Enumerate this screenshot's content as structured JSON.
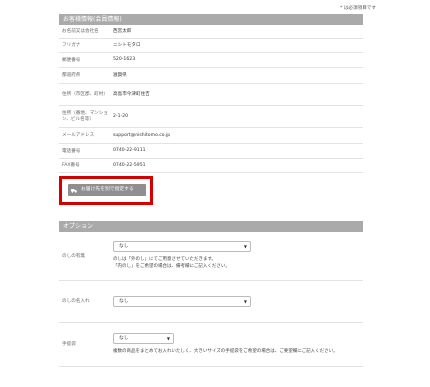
{
  "required_note": "* は必須項目です",
  "customer": {
    "header": "お客様情報(会員情報)",
    "rows": [
      {
        "label": "お名前又は会社名",
        "value": "西宮太郎"
      },
      {
        "label": "フリガナ",
        "value": "ニシトモタロ"
      },
      {
        "label": "郵便番号",
        "value": "520-1623"
      },
      {
        "label": "都道府県",
        "value": "滋賀県"
      },
      {
        "label": "住所（市区郡、町村）",
        "value": "高島市今津町住吉"
      },
      {
        "label": "住所（番地、マンション、ビル名等）",
        "value": "2-1-20"
      },
      {
        "label": "メールアドレス",
        "value": "support@nishitomo.co.jp"
      },
      {
        "label": "電話番号",
        "value": "0740-22-9111"
      },
      {
        "label": "FAX番号",
        "value": "0740-22-5951"
      }
    ]
  },
  "change_button_label": "お届け先を別で指定する",
  "options": {
    "header": "オプション",
    "noshi_presence": {
      "label": "のしの有無",
      "selected": "なし",
      "note1": "のしは「外のし」にてご用意させていただきます。",
      "note2": "「内のし」をご希望の場合は、備考欄にご記入ください。"
    },
    "noshi_name": {
      "label": "のしの名入れ",
      "selected": "なし"
    },
    "tebukuro": {
      "label": "手提袋",
      "selected": "なし",
      "note": "複数の商品をまとめてお入れいたしく、大きいサイズの手提袋をご希望の場合は、ご要望欄にご記入ください。"
    }
  }
}
